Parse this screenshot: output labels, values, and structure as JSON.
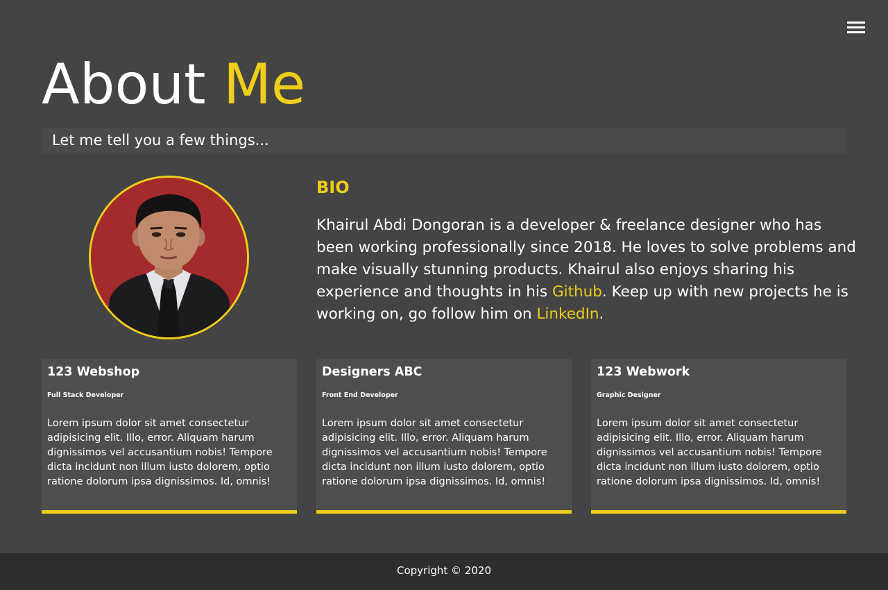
{
  "nav": {
    "menu_icon": "hamburger-menu-icon"
  },
  "header": {
    "title_main": "About",
    "title_accent": "Me",
    "subtitle": "Let me tell you a few things..."
  },
  "bio": {
    "title": "BIO",
    "text_part1": "Khairul Abdi Dongoran is a developer & freelance designer who has been working professionally since 2018. He loves to solve problems and make visually stunning products. Khairul also enjoys sharing his experience and thoughts in his ",
    "github_link": "Github",
    "text_part2": ". Keep up with new projects he is working on, go follow him on ",
    "linkedin_link": "LinkedIn",
    "text_part3": "."
  },
  "jobs": [
    {
      "company": "123 Webshop",
      "role": "Full Stack Developer",
      "description": "Lorem ipsum dolor sit amet consectetur adipisicing elit. Illo, error. Aliquam harum dignissimos vel accusantium nobis! Tempore dicta incidunt non illum iusto dolorem, optio ratione dolorum ipsa dignissimos. Id, omnis!"
    },
    {
      "company": "Designers ABC",
      "role": "Front End Developer",
      "description": "Lorem ipsum dolor sit amet consectetur adipisicing elit. Illo, error. Aliquam harum dignissimos vel accusantium nobis! Tempore dicta incidunt non illum iusto dolorem, optio ratione dolorum ipsa dignissimos. Id, omnis!"
    },
    {
      "company": "123 Webwork",
      "role": "Graphic Designer",
      "description": "Lorem ipsum dolor sit amet consectetur adipisicing elit. Illo, error. Aliquam harum dignissimos vel accusantium nobis! Tempore dicta incidunt non illum iusto dolorem, optio ratione dolorum ipsa dignissimos. Id, omnis!"
    }
  ],
  "footer": {
    "copyright": "Copyright © 2020"
  },
  "colors": {
    "background": "#444444",
    "accent": "#eece1a",
    "card": "#4e4e4e",
    "footer": "#2e2e2e"
  }
}
